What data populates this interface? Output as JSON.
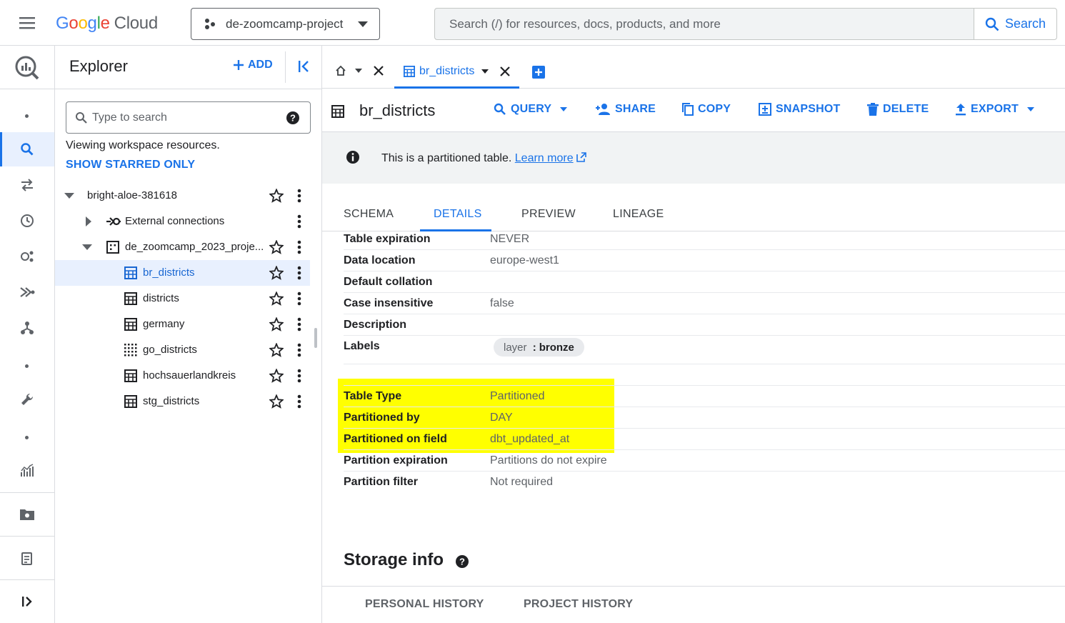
{
  "header": {
    "logo_letters": [
      "G",
      "o",
      "o",
      "g",
      "l",
      "e"
    ],
    "logo_cloud": "Cloud",
    "project": "de-zoomcamp-project",
    "search_placeholder": "Search (/) for resources, docs, products, and more",
    "search_button": "Search"
  },
  "explorer": {
    "title": "Explorer",
    "add_label": "ADD",
    "search_placeholder": "Type to search",
    "viewing_text": "Viewing workspace resources.",
    "starred_link": "SHOW STARRED ONLY",
    "tree": [
      {
        "label": "bright-aloe-381618",
        "kind": "project",
        "expanded": true
      },
      {
        "label": "External connections",
        "kind": "connections",
        "expanded": false
      },
      {
        "label": "de_zoomcamp_2023_proje...",
        "kind": "dataset",
        "expanded": true
      },
      {
        "label": "br_districts",
        "kind": "table",
        "selected": true
      },
      {
        "label": "districts",
        "kind": "table"
      },
      {
        "label": "germany",
        "kind": "table"
      },
      {
        "label": "go_districts",
        "kind": "view"
      },
      {
        "label": "hochsauerlandkreis",
        "kind": "table"
      },
      {
        "label": "stg_districts",
        "kind": "table"
      }
    ]
  },
  "tabs": {
    "active_tab": "br_districts"
  },
  "toolbar": {
    "table_name": "br_districts",
    "query": "QUERY",
    "share": "SHARE",
    "copy": "COPY",
    "snapshot": "SNAPSHOT",
    "delete": "DELETE",
    "export": "EXPORT"
  },
  "banner": {
    "text": "This is a partitioned table.",
    "link": "Learn more"
  },
  "detail_tabs": [
    "SCHEMA",
    "DETAILS",
    "PREVIEW",
    "LINEAGE"
  ],
  "details": {
    "rows": [
      {
        "key": "Table expiration",
        "value": "NEVER"
      },
      {
        "key": "Data location",
        "value": "europe-west1"
      },
      {
        "key": "Default collation",
        "value": ""
      },
      {
        "key": "Case insensitive",
        "value": "false"
      },
      {
        "key": "Description",
        "value": ""
      },
      {
        "key": "Labels",
        "value": ""
      }
    ],
    "label_chip": {
      "key": "layer",
      "sep": ":",
      "value": "bronze"
    },
    "partition_rows": [
      {
        "key": "Table Type",
        "value": "Partitioned"
      },
      {
        "key": "Partitioned by",
        "value": "DAY"
      },
      {
        "key": "Partitioned on field",
        "value": "dbt_updated_at"
      },
      {
        "key": "Partition expiration",
        "value": "Partitions do not expire"
      },
      {
        "key": "Partition filter",
        "value": "Not required"
      }
    ],
    "highlight_color": "#ffff00"
  },
  "storage": {
    "title": "Storage info",
    "tabs": [
      "PERSONAL HISTORY",
      "PROJECT HISTORY"
    ]
  },
  "colors": {
    "accent": "#1a73e8",
    "selected_bg": "#e8f0fe"
  }
}
